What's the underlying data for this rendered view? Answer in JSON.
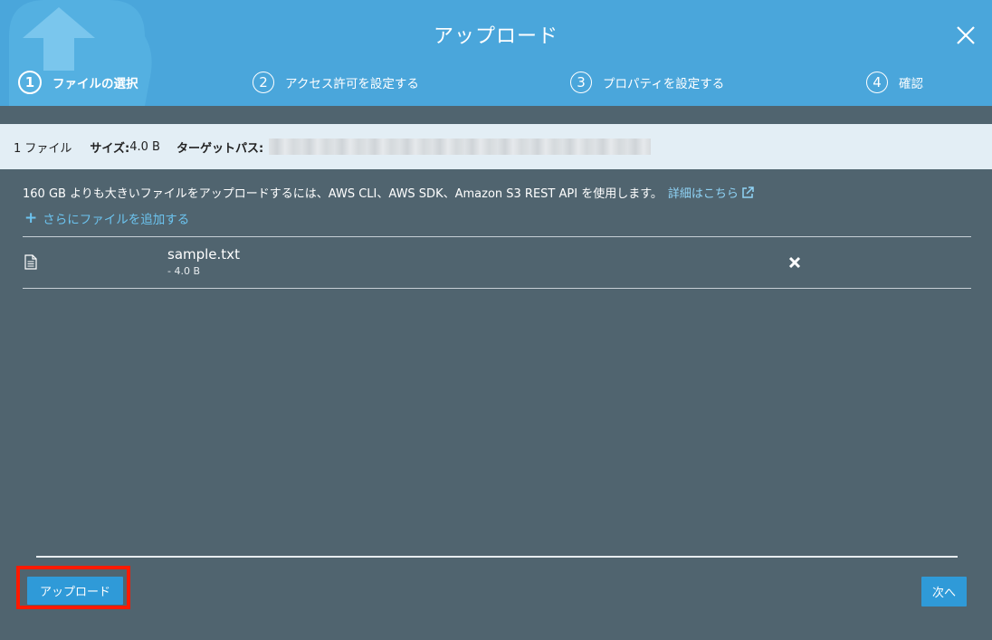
{
  "header": {
    "title": "アップロード",
    "steps": [
      {
        "num": "1",
        "label": "ファイルの選択"
      },
      {
        "num": "2",
        "label": "アクセス許可を設定する"
      },
      {
        "num": "3",
        "label": "プロパティを設定する"
      },
      {
        "num": "4",
        "label": "確認"
      }
    ],
    "active_step": 1
  },
  "info": {
    "count": "1 ファイル",
    "size_label": "サイズ:",
    "size_value": " 4.0 B",
    "path_label": "ターゲットパス:"
  },
  "notice": {
    "text": "160 GB よりも大きいファイルをアップロードするには、AWS CLI、AWS SDK、Amazon S3 REST API を使用します。",
    "link": "詳細はこちら"
  },
  "add_files": "さらにファイルを追加する",
  "files": [
    {
      "name": "sample.txt",
      "size": "- 4.0 B"
    }
  ],
  "buttons": {
    "upload": "アップロード",
    "next": "次へ"
  },
  "colors": {
    "header": "#4aa6db",
    "body": "#50646f",
    "info_bar": "#e3eef5",
    "button": "#2f9ad8",
    "highlight": "#ff1a00",
    "link": "#8fd3f6"
  }
}
